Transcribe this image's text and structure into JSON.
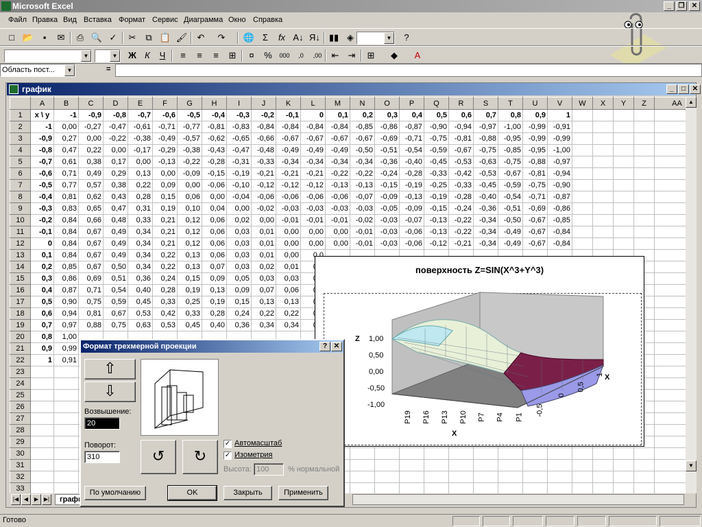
{
  "app": {
    "title": "Microsoft Excel"
  },
  "menu": [
    "Файл",
    "Правка",
    "Вид",
    "Вставка",
    "Формат",
    "Сервис",
    "Диаграмма",
    "Окно",
    "Справка"
  ],
  "formula_bar": {
    "name_box": "Область пост...",
    "equals": "="
  },
  "workbook": {
    "title": "график",
    "sheet_tab": "графи"
  },
  "columns": [
    "",
    "A",
    "B",
    "C",
    "D",
    "E",
    "F",
    "G",
    "H",
    "I",
    "J",
    "K",
    "L",
    "M",
    "N",
    "O",
    "P",
    "Q",
    "R",
    "S",
    "T",
    "U",
    "V",
    "W",
    "X",
    "Y",
    "Z",
    "AA"
  ],
  "header_row": [
    "x \\ y",
    "-1",
    "-0,9",
    "-0,8",
    "-0,7",
    "-0,6",
    "-0,5",
    "-0,4",
    "-0,3",
    "-0,2",
    "-0,1",
    "0",
    "0,1",
    "0,2",
    "0,3",
    "0,4",
    "0,5",
    "0,6",
    "0,7",
    "0,8",
    "0,9",
    "1"
  ],
  "rows": [
    [
      "-1",
      "0,00",
      "-0,27",
      "-0,47",
      "-0,61",
      "-0,71",
      "-0,77",
      "-0,81",
      "-0,83",
      "-0,84",
      "-0,84",
      "-0,84",
      "-0,84",
      "-0,85",
      "-0,86",
      "-0,87",
      "-0,90",
      "-0,94",
      "-0,97",
      "-1,00",
      "-0,99",
      "-0,91"
    ],
    [
      "-0,9",
      "0,27",
      "0,00",
      "-0,22",
      "-0,38",
      "-0,49",
      "-0,57",
      "-0,62",
      "-0,65",
      "-0,66",
      "-0,67",
      "-0,67",
      "-0,67",
      "-0,67",
      "-0,69",
      "-0,71",
      "-0,75",
      "-0,81",
      "-0,88",
      "-0,95",
      "-0,99",
      "-0,99"
    ],
    [
      "-0,8",
      "0,47",
      "0,22",
      "0,00",
      "-0,17",
      "-0,29",
      "-0,38",
      "-0,43",
      "-0,47",
      "-0,48",
      "-0,49",
      "-0,49",
      "-0,49",
      "-0,50",
      "-0,51",
      "-0,54",
      "-0,59",
      "-0,67",
      "-0,75",
      "-0,85",
      "-0,95",
      "-1,00"
    ],
    [
      "-0,7",
      "0,61",
      "0,38",
      "0,17",
      "0,00",
      "-0,13",
      "-0,22",
      "-0,28",
      "-0,31",
      "-0,33",
      "-0,34",
      "-0,34",
      "-0,34",
      "-0,34",
      "-0,36",
      "-0,40",
      "-0,45",
      "-0,53",
      "-0,63",
      "-0,75",
      "-0,88",
      "-0,97"
    ],
    [
      "-0,6",
      "0,71",
      "0,49",
      "0,29",
      "0,13",
      "0,00",
      "-0,09",
      "-0,15",
      "-0,19",
      "-0,21",
      "-0,21",
      "-0,21",
      "-0,22",
      "-0,22",
      "-0,24",
      "-0,28",
      "-0,33",
      "-0,42",
      "-0,53",
      "-0,67",
      "-0,81",
      "-0,94"
    ],
    [
      "-0,5",
      "0,77",
      "0,57",
      "0,38",
      "0,22",
      "0,09",
      "0,00",
      "-0,06",
      "-0,10",
      "-0,12",
      "-0,12",
      "-0,12",
      "-0,13",
      "-0,13",
      "-0,15",
      "-0,19",
      "-0,25",
      "-0,33",
      "-0,45",
      "-0,59",
      "-0,75",
      "-0,90"
    ],
    [
      "-0,4",
      "0,81",
      "0,62",
      "0,43",
      "0,28",
      "0,15",
      "0,06",
      "0,00",
      "-0,04",
      "-0,06",
      "-0,06",
      "-0,06",
      "-0,06",
      "-0,07",
      "-0,09",
      "-0,13",
      "-0,19",
      "-0,28",
      "-0,40",
      "-0,54",
      "-0,71",
      "-0,87"
    ],
    [
      "-0,3",
      "0,83",
      "0,65",
      "0,47",
      "0,31",
      "0,19",
      "0,10",
      "0,04",
      "0,00",
      "-0,02",
      "-0,03",
      "-0,03",
      "-0,03",
      "-0,03",
      "-0,05",
      "-0,09",
      "-0,15",
      "-0,24",
      "-0,36",
      "-0,51",
      "-0,69",
      "-0,86"
    ],
    [
      "-0,2",
      "0,84",
      "0,66",
      "0,48",
      "0,33",
      "0,21",
      "0,12",
      "0,06",
      "0,02",
      "0,00",
      "-0,01",
      "-0,01",
      "-0,01",
      "-0,02",
      "-0,03",
      "-0,07",
      "-0,13",
      "-0,22",
      "-0,34",
      "-0,50",
      "-0,67",
      "-0,85"
    ],
    [
      "-0,1",
      "0,84",
      "0,67",
      "0,49",
      "0,34",
      "0,21",
      "0,12",
      "0,06",
      "0,03",
      "0,01",
      "0,00",
      "0,00",
      "0,00",
      "-0,01",
      "-0,03",
      "-0,06",
      "-0,13",
      "-0,22",
      "-0,34",
      "-0,49",
      "-0,67",
      "-0,84"
    ],
    [
      "0",
      "0,84",
      "0,67",
      "0,49",
      "0,34",
      "0,21",
      "0,12",
      "0,06",
      "0,03",
      "0,01",
      "0,00",
      "0,00",
      "0,00",
      "-0,01",
      "-0,03",
      "-0,06",
      "-0,12",
      "-0,21",
      "-0,34",
      "-0,49",
      "-0,67",
      "-0,84"
    ],
    [
      "0,1",
      "0,84",
      "0,67",
      "0,49",
      "0,34",
      "0,22",
      "0,13",
      "0,06",
      "0,03",
      "0,01",
      "0,00",
      "0,0",
      "",
      "",
      "",
      "",
      "",
      "",
      "",
      "",
      "",
      ""
    ],
    [
      "0,2",
      "0,85",
      "0,67",
      "0,50",
      "0,34",
      "0,22",
      "0,13",
      "0,07",
      "0,03",
      "0,02",
      "0,01",
      "0,0",
      "",
      "",
      "",
      "",
      "",
      "",
      "",
      "",
      "",
      ""
    ],
    [
      "0,3",
      "0,86",
      "0,69",
      "0,51",
      "0,36",
      "0,24",
      "0,15",
      "0,09",
      "0,05",
      "0,03",
      "0,03",
      "0,0",
      "",
      "",
      "",
      "",
      "",
      "",
      "",
      "",
      "",
      ""
    ],
    [
      "0,4",
      "0,87",
      "0,71",
      "0,54",
      "0,40",
      "0,28",
      "0,19",
      "0,13",
      "0,09",
      "0,07",
      "0,06",
      "0,0",
      "",
      "",
      "",
      "",
      "",
      "",
      "",
      "",
      "",
      ""
    ],
    [
      "0,5",
      "0,90",
      "0,75",
      "0,59",
      "0,45",
      "0,33",
      "0,25",
      "0,19",
      "0,15",
      "0,13",
      "0,13",
      "0,1",
      "",
      "",
      "",
      "",
      "",
      "",
      "",
      "",
      "",
      ""
    ],
    [
      "0,6",
      "0,94",
      "0,81",
      "0,67",
      "0,53",
      "0,42",
      "0,33",
      "0,28",
      "0,24",
      "0,22",
      "0,22",
      "0,2",
      "",
      "",
      "",
      "",
      "",
      "",
      "",
      "",
      "",
      ""
    ],
    [
      "0,7",
      "0,97",
      "0,88",
      "0,75",
      "0,63",
      "0,53",
      "0,45",
      "0,40",
      "0,36",
      "0,34",
      "0,34",
      "0,3",
      "",
      "",
      "",
      "",
      "",
      "",
      "",
      "",
      "",
      ""
    ],
    [
      "0,8",
      "1,00",
      "",
      "",
      "",
      "",
      "",
      "",
      "",
      "",
      "",
      "",
      "",
      "",
      "",
      "",
      "",
      "",
      "",
      "",
      "",
      ""
    ],
    [
      "0,9",
      "0,99",
      "",
      "",
      "",
      "",
      "",
      "",
      "",
      "",
      "",
      "",
      "",
      "",
      "",
      "",
      "",
      "",
      "",
      "",
      "",
      ""
    ],
    [
      "1",
      "0,91",
      "",
      "",
      "",
      "",
      "",
      "",
      "",
      "",
      "",
      "",
      "",
      "",
      "",
      "",
      "",
      "",
      "",
      "",
      "",
      ""
    ]
  ],
  "empty_row_numbers": [
    "23",
    "24",
    "25",
    "26",
    "27",
    "28",
    "29",
    "30",
    "31",
    "32",
    "33"
  ],
  "chart": {
    "title": "поверхность Z=SIN(X^3+Y^3)",
    "z_label": "Z",
    "x_label_front": "X",
    "x_label_side": "X",
    "z_ticks": [
      "1,00",
      "0,50",
      "0,00",
      "-0,50",
      "-1,00"
    ],
    "front_ticks": [
      "P19",
      "P16",
      "P13",
      "P10",
      "P7",
      "P4",
      "P1"
    ],
    "side_ticks": [
      "-0,5",
      "0",
      "0,5",
      "1"
    ]
  },
  "chart_data": {
    "type": "surface",
    "title": "поверхность Z=SIN(X^3+Y^3)",
    "zlabel": "Z",
    "xlabel": "X",
    "zlim": [
      -1,
      1
    ]
  },
  "dialog": {
    "title": "Формат трехмерной проекции",
    "elevation_label": "Возвышение:",
    "elevation_value": "20",
    "rotation_label": "Поворот:",
    "rotation_value": "310",
    "autoscale_label": "Автомасштаб",
    "isometry_label": "Изометрия",
    "height_label": "Высота:",
    "height_value": "100",
    "height_unit": "% нормальной",
    "default_button": "По умолчанию",
    "ok_button": "OK",
    "close_button": "Закрыть",
    "apply_button": "Применить",
    "help_button": "?",
    "close_x": "✕"
  },
  "status": {
    "text": "Готово"
  }
}
